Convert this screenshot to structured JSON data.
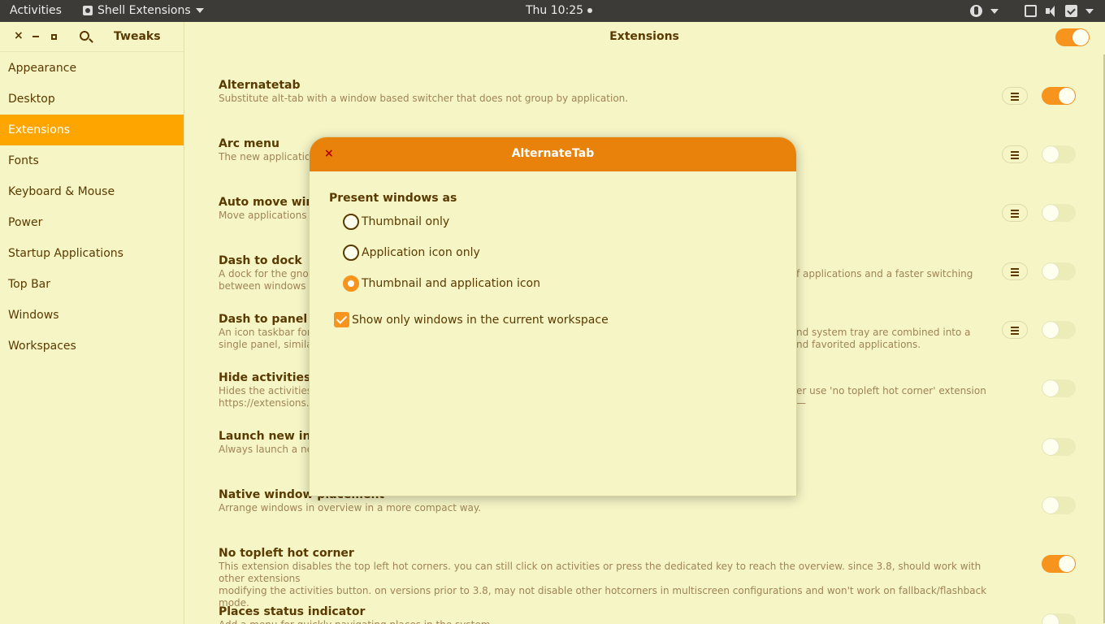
{
  "topbar": {
    "activities": "Activities",
    "app_name": "Shell Extensions",
    "clock": "Thu 10:25",
    "icons": [
      "accessibility-icon",
      "network-icon",
      "volume-icon",
      "clipboard-icon"
    ]
  },
  "sidebar": {
    "title": "Tweaks",
    "close_glyph": "×",
    "items": [
      {
        "label": "Appearance"
      },
      {
        "label": "Desktop"
      },
      {
        "label": "Extensions"
      },
      {
        "label": "Fonts"
      },
      {
        "label": "Keyboard & Mouse"
      },
      {
        "label": "Power"
      },
      {
        "label": "Startup Applications"
      },
      {
        "label": "Top Bar"
      },
      {
        "label": "Windows"
      },
      {
        "label": "Workspaces"
      }
    ],
    "active_index": 2
  },
  "main": {
    "title": "Extensions",
    "master_toggle_on": true,
    "extensions": [
      {
        "name": "Alternatetab",
        "desc": "Substitute alt-tab with a window based switcher that does not group by application.",
        "has_settings": true,
        "enabled": true
      },
      {
        "name": "Arc menu",
        "desc": "The new applications",
        "has_settings": true,
        "enabled": false
      },
      {
        "name": "Auto move wind",
        "desc": "Move applications to",
        "has_settings": true,
        "enabled": false
      },
      {
        "name": "Dash to dock",
        "desc": "A dock for the gnome",
        "desc_right": "f applications and a faster switching",
        "desc2": "between windows a",
        "has_settings": true,
        "enabled": false
      },
      {
        "name": "Dash to panel",
        "desc": "An icon taskbar for t",
        "desc_right": "nd system tray are combined into a",
        "desc2": "single panel, similar",
        "desc2_right": "nd favorited applications.",
        "has_settings": true,
        "enabled": false
      },
      {
        "name": "Hide activities b",
        "desc": "Hides the activities b",
        "desc_right": "er use 'no topleft hot corner' extension —",
        "desc2": "https://extensions.g",
        "has_settings": false,
        "enabled": false
      },
      {
        "name": "Launch new inst",
        "desc": "Always launch a new",
        "has_settings": false,
        "enabled": false
      },
      {
        "name": "Native window placement",
        "desc": "Arrange windows in overview in a more compact way.",
        "has_settings": false,
        "enabled": false
      },
      {
        "name": "No topleft hot corner",
        "desc": "This extension disables the top left hot corners. you can still click on activities or press the dedicated key to reach the overview. since 3.8, should work with other extensions",
        "desc2": "modifying the activities button. on versions prior to 3.8, may not disable other hotcorners in multiscreen configurations and won't work on fallback/flashback mode.",
        "has_settings": false,
        "enabled": true
      },
      {
        "name": "Places status indicator",
        "desc": "Add a menu for quickly navigating places in the system.",
        "has_settings": false,
        "enabled": false
      }
    ]
  },
  "dialog": {
    "title": "AlternateTab",
    "close_glyph": "×",
    "section_label": "Present windows as",
    "options": [
      {
        "label": "Thumbnail only",
        "checked": false
      },
      {
        "label": "Application icon only",
        "checked": false
      },
      {
        "label": "Thumbnail and application icon",
        "checked": true
      }
    ],
    "checkbox_label": "Show only windows in the current workspace",
    "checkbox_checked": true
  },
  "colors": {
    "accent": "#f7941d",
    "dialog_header": "#e8820a",
    "background": "#f5f5c6",
    "text": "#5a3a00"
  }
}
